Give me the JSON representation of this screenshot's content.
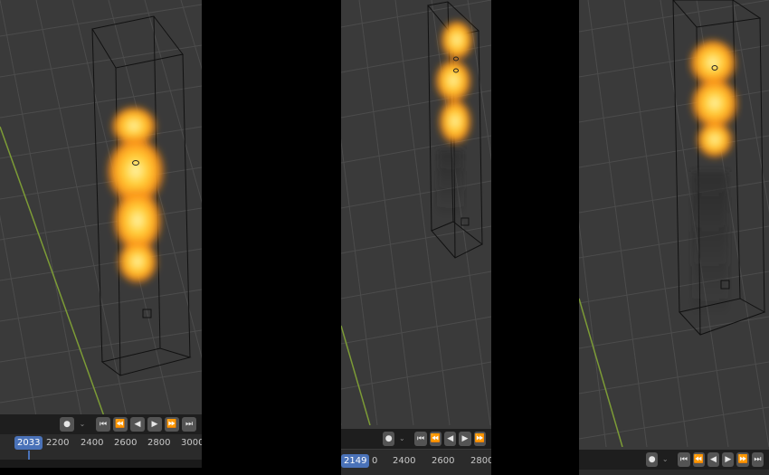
{
  "panels": [
    {
      "toolbar": {
        "keyframe_icon": "●",
        "dropdown_icon": "⌄",
        "transport_icons": [
          "⏮",
          "⏪",
          "◀",
          "▶",
          "⏩",
          "⏭"
        ]
      },
      "timeline": {
        "current_frame": "2033",
        "ticks": [
          "2200",
          "2400",
          "2600",
          "2800",
          "3000"
        ]
      }
    },
    {
      "toolbar": {
        "keyframe_icon": "●",
        "dropdown_icon": "⌄",
        "transport_icons": [
          "⏮",
          "⏪",
          "◀",
          "▶",
          "⏩"
        ]
      },
      "timeline": {
        "current_frame": "2149",
        "ticks": [
          "0",
          "2400",
          "2600",
          "2800"
        ]
      }
    },
    {
      "toolbar": {
        "keyframe_icon": "●",
        "dropdown_icon": "⌄",
        "transport_icons": [
          "⏮",
          "⏪",
          "◀",
          "▶",
          "⏩",
          "⏭"
        ]
      }
    }
  ],
  "colors": {
    "viewport_bg": "#3a3a3a",
    "grid": "#4c4c4c",
    "axis_y": "#7c9b36",
    "fire_core": "#fff3a0",
    "fire_mid": "#ffb020",
    "fire_edge": "#e8700e",
    "playhead": "#4a72b8"
  }
}
